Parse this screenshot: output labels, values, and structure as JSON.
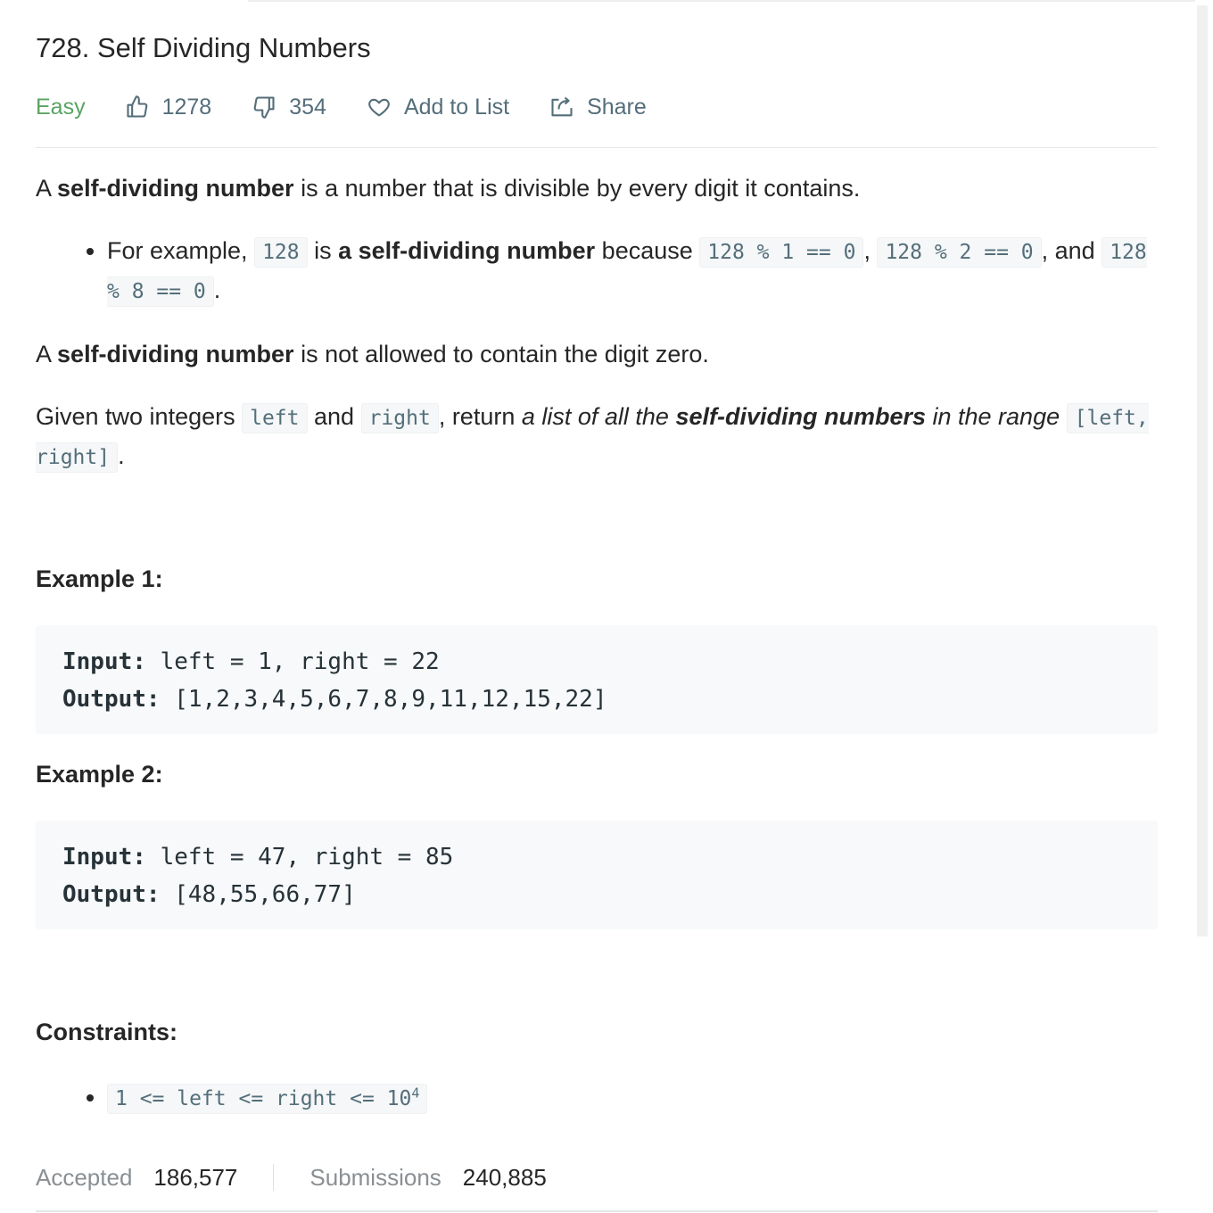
{
  "problem": {
    "title": "728. Self Dividing Numbers",
    "difficulty": "Easy",
    "likes": "1278",
    "dislikes": "354",
    "add_to_list": "Add to List",
    "share": "Share"
  },
  "description": {
    "p1": {
      "a": "A ",
      "bold": "self-dividing number",
      "rest": " is a number that is divisible by every digit it contains."
    },
    "bullet": {
      "t1": "For example, ",
      "code1": "128",
      "t2": " is ",
      "bold": "a self-dividing number",
      "t3": " because ",
      "code2": "128 % 1 == 0",
      "t4": ", ",
      "code3": "128 % 2 == 0",
      "t5": ", and ",
      "code4": "128 % 8 == 0",
      "t6": "."
    },
    "p2": {
      "a": "A ",
      "bold": "self-dividing number",
      "rest": " is not allowed to contain the digit zero."
    },
    "p3": {
      "t1": "Given two integers ",
      "code1": "left",
      "t2": " and ",
      "code2": "right",
      "t3": ", return ",
      "i1": "a list of all the ",
      "bi": "self-dividing numbers",
      "i2": " in the range",
      "t4": " ",
      "code3": "[left, right]",
      "t5": "."
    }
  },
  "examples": [
    {
      "heading": "Example 1:",
      "input_label": "Input:",
      "input": " left = 1, right = 22",
      "output_label": "Output:",
      "output": " [1,2,3,4,5,6,7,8,9,11,12,15,22]"
    },
    {
      "heading": "Example 2:",
      "input_label": "Input:",
      "input": " left = 47, right = 85",
      "output_label": "Output:",
      "output": " [48,55,66,77]"
    }
  ],
  "constraints": {
    "heading": "Constraints:",
    "item_base": "1 <= left <= right <= 10",
    "item_exp": "4"
  },
  "stats": {
    "accepted_label": "Accepted",
    "accepted": "186,577",
    "submissions_label": "Submissions",
    "submissions": "240,885"
  },
  "colors": {
    "easy": "#5aa363",
    "code_bg": "#f5f7f8",
    "example_bg": "#f7f9fa"
  }
}
